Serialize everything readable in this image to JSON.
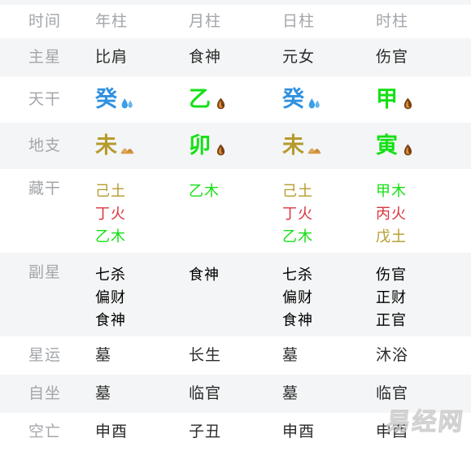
{
  "table": {
    "header": {
      "label": "时间",
      "columns": [
        "年柱",
        "月柱",
        "日柱",
        "时柱"
      ]
    },
    "rows": [
      {
        "label": "主星",
        "type": "single",
        "shaded": true,
        "values": [
          "比肩",
          "食神",
          "元女",
          "伤官"
        ]
      },
      {
        "label": "天干",
        "type": "pillar",
        "shaded": false,
        "cells": [
          {
            "char": "癸",
            "element": "water",
            "icon": "water-droplets-icon"
          },
          {
            "char": "乙",
            "element": "wood",
            "icon": "wood-log-icon"
          },
          {
            "char": "癸",
            "element": "water",
            "icon": "water-droplets-icon"
          },
          {
            "char": "甲",
            "element": "wood",
            "icon": "wood-log-icon"
          }
        ]
      },
      {
        "label": "地支",
        "type": "pillar",
        "shaded": true,
        "cells": [
          {
            "char": "未",
            "element": "earth",
            "icon": "earth-mound-icon"
          },
          {
            "char": "卯",
            "element": "wood",
            "icon": "wood-log-icon"
          },
          {
            "char": "未",
            "element": "earth",
            "icon": "earth-mound-icon"
          },
          {
            "char": "寅",
            "element": "wood",
            "icon": "wood-log-icon"
          }
        ]
      },
      {
        "label": "藏干",
        "type": "multi",
        "shaded": false,
        "columns": [
          [
            {
              "text": "己土",
              "element": "earth"
            },
            {
              "text": "丁火",
              "element": "fire"
            },
            {
              "text": "乙木",
              "element": "wood"
            }
          ],
          [
            {
              "text": "乙木",
              "element": "wood"
            }
          ],
          [
            {
              "text": "己土",
              "element": "earth"
            },
            {
              "text": "丁火",
              "element": "fire"
            },
            {
              "text": "乙木",
              "element": "wood"
            }
          ],
          [
            {
              "text": "甲木",
              "element": "wood"
            },
            {
              "text": "丙火",
              "element": "fire"
            },
            {
              "text": "戊土",
              "element": "earth"
            }
          ]
        ]
      },
      {
        "label": "副星",
        "type": "multi",
        "shaded": true,
        "columns": [
          [
            {
              "text": "七杀",
              "element": "plain"
            },
            {
              "text": "偏财",
              "element": "plain"
            },
            {
              "text": "食神",
              "element": "plain"
            }
          ],
          [
            {
              "text": "食神",
              "element": "plain"
            }
          ],
          [
            {
              "text": "七杀",
              "element": "plain"
            },
            {
              "text": "偏财",
              "element": "plain"
            },
            {
              "text": "食神",
              "element": "plain"
            }
          ],
          [
            {
              "text": "伤官",
              "element": "plain"
            },
            {
              "text": "正财",
              "element": "plain"
            },
            {
              "text": "正官",
              "element": "plain"
            }
          ]
        ]
      },
      {
        "label": "星运",
        "type": "single",
        "shaded": false,
        "values": [
          "墓",
          "长生",
          "墓",
          "沐浴"
        ]
      },
      {
        "label": "自坐",
        "type": "single",
        "shaded": true,
        "values": [
          "墓",
          "临官",
          "墓",
          "临官"
        ]
      },
      {
        "label": "空亡",
        "type": "single",
        "shaded": false,
        "values": [
          "申酉",
          "子丑",
          "申酉",
          "申酉"
        ]
      }
    ]
  },
  "watermark": {
    "text": "易经网"
  },
  "colors": {
    "wood": "#15e015",
    "fire": "#d9363e",
    "earth": "#b59b2c",
    "water": "#2f91e0",
    "label_gray": "#a3a6ab",
    "value_dark": "#2b2b2b",
    "row_shade": "#f4f5f6"
  }
}
